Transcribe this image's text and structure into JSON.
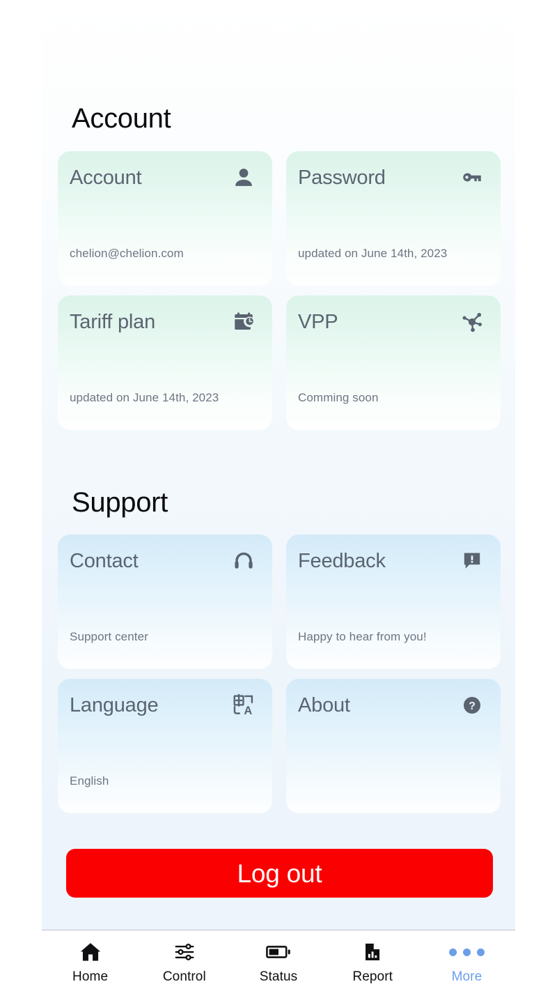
{
  "sections": [
    {
      "id": "account",
      "heading": "Account",
      "cards": [
        {
          "title": "Account",
          "subtitle": "chelion@chelion.com",
          "icon": "person-icon"
        },
        {
          "title": "Password",
          "subtitle": "updated on June 14th, 2023",
          "icon": "key-icon"
        },
        {
          "title": "Tariff plan",
          "subtitle": "updated on June 14th, 2023",
          "icon": "calendar-clock-icon"
        },
        {
          "title": "VPP",
          "subtitle": "Comming soon",
          "icon": "network-hub-icon"
        }
      ]
    },
    {
      "id": "support",
      "heading": "Support",
      "cards": [
        {
          "title": "Contact",
          "subtitle": "Support center",
          "icon": "headset-icon"
        },
        {
          "title": "Feedback",
          "subtitle": "Happy to hear from you!",
          "icon": "feedback-bubble-icon"
        },
        {
          "title": "Language",
          "subtitle": "English",
          "icon": "translate-icon"
        },
        {
          "title": "About",
          "subtitle": "",
          "icon": "help-circle-icon"
        }
      ]
    }
  ],
  "logout": {
    "label": "Log out"
  },
  "tabbar": {
    "items": [
      {
        "label": "Home",
        "icon": "home-icon",
        "active": false
      },
      {
        "label": "Control",
        "icon": "sliders-icon",
        "active": false
      },
      {
        "label": "Status",
        "icon": "battery-icon",
        "active": false
      },
      {
        "label": "Report",
        "icon": "report-icon",
        "active": false
      },
      {
        "label": "More",
        "icon": "dots-icon",
        "active": true
      }
    ]
  },
  "colors": {
    "logout_red": "#FA0000",
    "active_tab_blue": "#6C9FE8",
    "card_green": "#DCF4EA",
    "card_blue": "#D5EAF8",
    "icon_slate": "#5A6370",
    "card_title": "#5B6471",
    "card_subtitle": "#6C7682"
  }
}
